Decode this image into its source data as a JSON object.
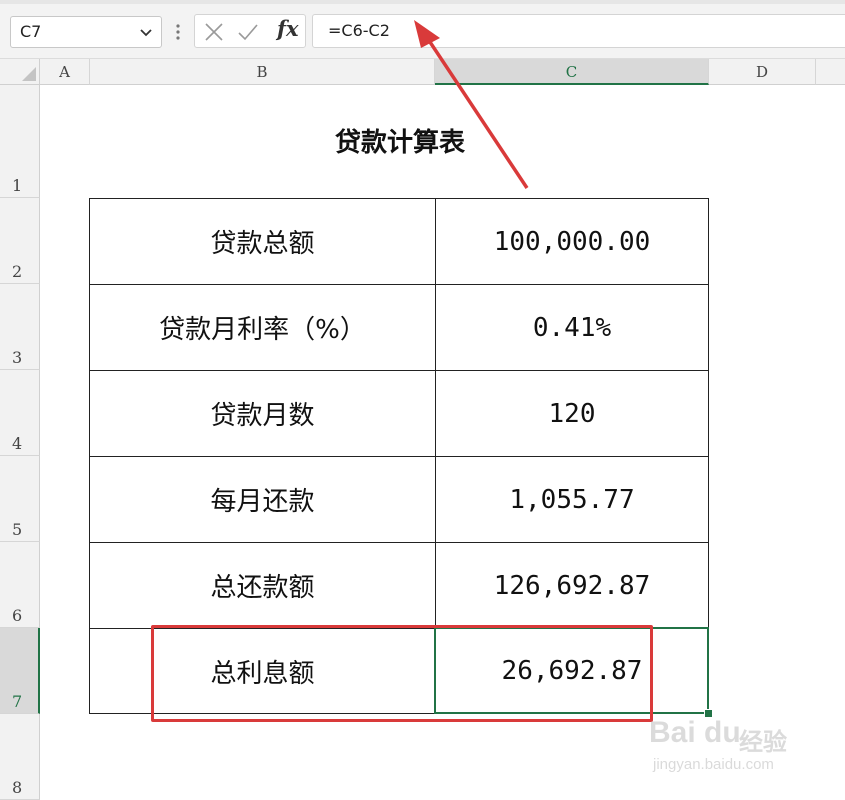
{
  "formula_bar": {
    "name_box": "C7",
    "formula": "=C6-C2",
    "fx_label": "fx"
  },
  "columns": [
    "A",
    "B",
    "C",
    "D"
  ],
  "rows": [
    "1",
    "2",
    "3",
    "4",
    "5",
    "6",
    "7",
    "8"
  ],
  "selected_column": "C",
  "selected_row": "7",
  "sheet": {
    "title": "贷款计算表",
    "table": [
      {
        "label": "贷款总额",
        "value": "100,000.00"
      },
      {
        "label": "贷款月利率（%）",
        "value": "0.41%"
      },
      {
        "label": "贷款月数",
        "value": "120"
      },
      {
        "label": "每月还款",
        "value": "1,055.77"
      },
      {
        "label": "总还款额",
        "value": "126,692.87"
      },
      {
        "label": "总利息额",
        "value": "26,692.87"
      }
    ]
  },
  "colors": {
    "selection_green": "#217346",
    "annotation_red": "#d93a3a"
  },
  "watermark": {
    "logo": "Bai du",
    "jingyan": "经验",
    "url": "jingyan.baidu.com"
  }
}
